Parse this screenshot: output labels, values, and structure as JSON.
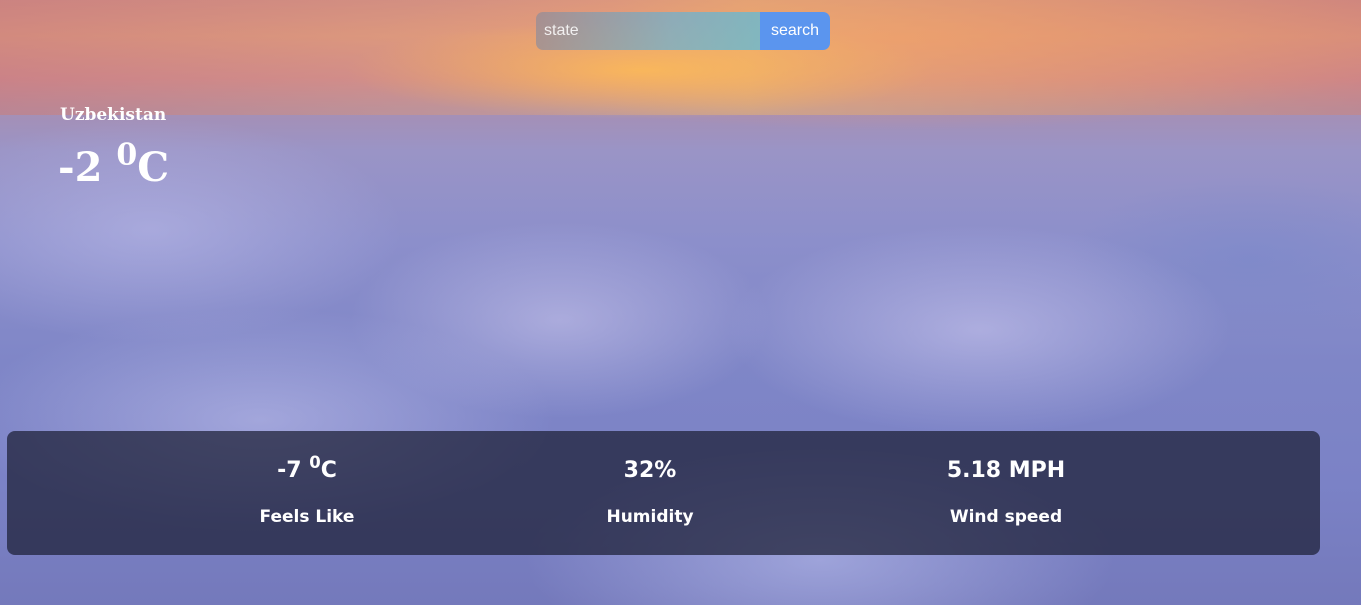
{
  "search": {
    "placeholder": "state",
    "button_label": "search"
  },
  "current": {
    "location": "Uzbekistan",
    "temperature": "-2 ",
    "degree_symbol": "0",
    "unit": "C"
  },
  "details": {
    "feels_like": {
      "value": "-7 ",
      "degree_symbol": "0",
      "unit": "C",
      "label": "Feels Like"
    },
    "humidity": {
      "value": "32%",
      "label": "Humidity"
    },
    "wind": {
      "value": "5.18 MPH",
      "label": "Wind speed"
    }
  }
}
